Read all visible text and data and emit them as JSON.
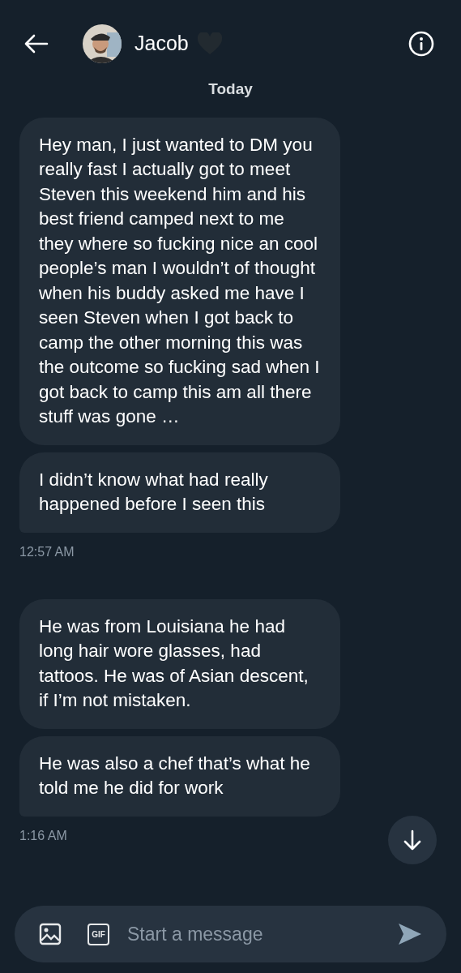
{
  "header": {
    "name": "Jacob"
  },
  "day_label": "Today",
  "groups": [
    {
      "messages": [
        "Hey man, I just wanted to DM you really fast I actually got to meet Steven this weekend him and his best friend camped next to me they where so fucking nice an cool people’s man I wouldn’t of thought when his buddy asked me have I seen Steven when I got back to camp the other morning this was the outcome so fucking sad when I got back to camp this am all there stuff was gone …",
        "I didn’t know what had really happened before I seen this"
      ],
      "time": "12:57 AM"
    },
    {
      "messages": [
        "He was from Louisiana he had long hair wore glasses, had tattoos. He was of Asian descent, if I’m not mistaken.",
        "He was also a chef that’s what he told me he did for work"
      ],
      "time": "1:16 AM"
    }
  ],
  "composer": {
    "gif_label": "GIF",
    "placeholder": "Start a message"
  }
}
